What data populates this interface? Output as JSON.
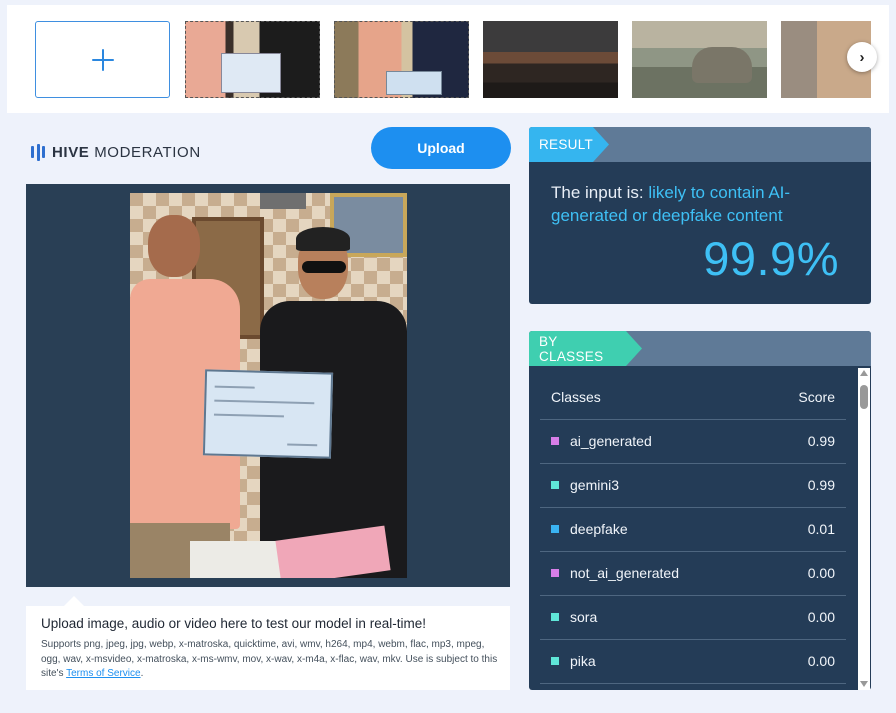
{
  "strip": {
    "add_label": "+",
    "next_icon": "›",
    "thumbnails": [
      "thumb-1",
      "thumb-2",
      "thumb-3",
      "thumb-4",
      "thumb-5"
    ]
  },
  "logo": {
    "brand": "HIVE",
    "product": "MODERATION"
  },
  "upload": {
    "label": "Upload"
  },
  "info": {
    "title": "Upload image, audio or video here to test our model in real-time!",
    "supports": "Supports png, jpeg, jpg, webp, x-matroska, quicktime, avi, wmv, h264, mp4, webm, flac, mp3, mpeg, ogg, wav, x-msvideo, x-matroska, x-ms-wmv, mov, x-wav, x-m4a, x-flac, wav, mkv. Use is subject to this site's",
    "tos_link": "Terms of Service",
    "tos_end": "."
  },
  "result": {
    "tag": "RESULT",
    "prefix": "The input is: ",
    "verdict": "likely to contain AI-generated or deepfake content",
    "score": "99.9%"
  },
  "classes": {
    "tag": "BY CLASSES",
    "col_class": "Classes",
    "col_score": "Score",
    "rows": [
      {
        "name": "ai_generated",
        "score": "0.99",
        "color": "#d77ee8"
      },
      {
        "name": "gemini3",
        "score": "0.99",
        "color": "#5fe6d8"
      },
      {
        "name": "deepfake",
        "score": "0.01",
        "color": "#3ab3f2"
      },
      {
        "name": "not_ai_generated",
        "score": "0.00",
        "color": "#d77ee8"
      },
      {
        "name": "sora",
        "score": "0.00",
        "color": "#5fe6d8"
      },
      {
        "name": "pika",
        "score": "0.00",
        "color": "#5fe6d8"
      }
    ]
  },
  "colors": {
    "accent": "#1d8ff0",
    "panel": "#243c57",
    "result_highlight": "#3ec0f5",
    "result_tag": "#35b5ef",
    "classes_tag": "#3fcfb0"
  }
}
